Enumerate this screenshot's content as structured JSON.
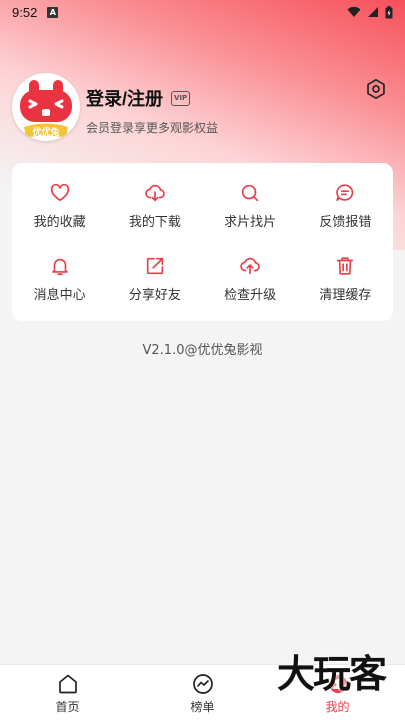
{
  "status_bar": {
    "time": "9:52",
    "notif_glyph": "A"
  },
  "profile": {
    "title": "登录/注册",
    "vip_badge": "VIP",
    "subtitle": "会员登录享更多观影权益",
    "avatar_text": "优优兔"
  },
  "menu": [
    {
      "label": "我的收藏",
      "icon": "heart-icon"
    },
    {
      "label": "我的下载",
      "icon": "cloud-download-icon"
    },
    {
      "label": "求片找片",
      "icon": "search-icon"
    },
    {
      "label": "反馈报错",
      "icon": "chat-bubble-icon"
    },
    {
      "label": "消息中心",
      "icon": "bell-icon"
    },
    {
      "label": "分享好友",
      "icon": "share-icon"
    },
    {
      "label": "检查升级",
      "icon": "cloud-upload-icon"
    },
    {
      "label": "清理缓存",
      "icon": "trash-icon"
    }
  ],
  "version_text": "V2.1.0@优优兔影视",
  "tabs": [
    {
      "label": "首页",
      "icon": "home-icon"
    },
    {
      "label": "榜单",
      "icon": "trend-icon"
    },
    {
      "label": "我的",
      "icon": "profile-icon",
      "active": true
    }
  ],
  "watermark": "大玩客",
  "colors": {
    "accent": "#f03a48",
    "hero_top": "#f7505c"
  }
}
